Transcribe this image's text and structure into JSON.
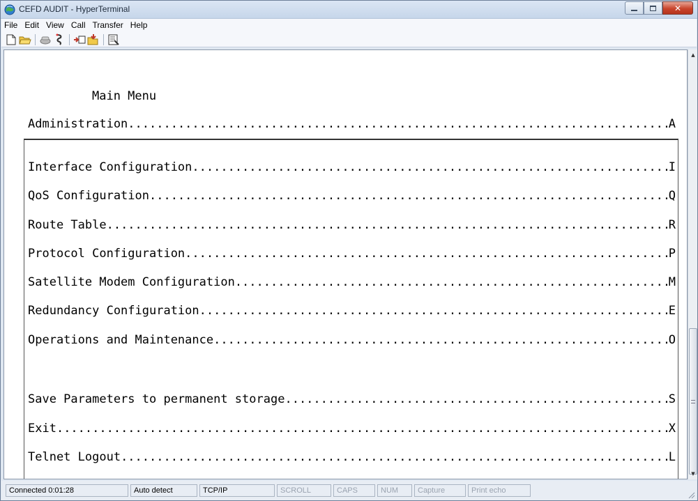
{
  "window": {
    "title": "CEFD AUDIT - HyperTerminal",
    "icon": "hyperterminal-globe-icon"
  },
  "menubar": {
    "items": [
      "File",
      "Edit",
      "View",
      "Call",
      "Transfer",
      "Help"
    ]
  },
  "toolbar": {
    "icons": [
      "new-document-icon",
      "open-folder-icon",
      "connect-phone-icon",
      "disconnect-icon",
      "send-file-icon",
      "receive-file-icon",
      "properties-icon"
    ]
  },
  "terminal": {
    "heading": "Main Menu",
    "top_item": {
      "label": "Administration",
      "key": "A"
    },
    "items": [
      {
        "label": "Interface Configuration",
        "key": "I"
      },
      {
        "label": "QoS Configuration",
        "key": "Q"
      },
      {
        "label": "Route Table",
        "key": "R"
      },
      {
        "label": "Protocol Configuration",
        "key": "P"
      },
      {
        "label": "Satellite Modem Configuration",
        "key": "M"
      },
      {
        "label": "Redundancy Configuration",
        "key": "E"
      },
      {
        "label": "Operations and Maintenance",
        "key": "O"
      }
    ],
    "bottom_items": [
      {
        "label": "Save Parameters to permanent storage",
        "key": "S"
      },
      {
        "label": "Exit",
        "key": "X"
      },
      {
        "label": "Telnet Logout",
        "key": "L"
      }
    ]
  },
  "statusbar": {
    "connected": "Connected 0:01:28",
    "detect": "Auto detect",
    "protocol": "TCP/IP",
    "scroll": "SCROLL",
    "caps": "CAPS",
    "num": "NUM",
    "capture": "Capture",
    "print_echo": "Print echo"
  },
  "colors": {
    "close_button": "#c9452c",
    "terminal_bg": "#ffffff"
  }
}
